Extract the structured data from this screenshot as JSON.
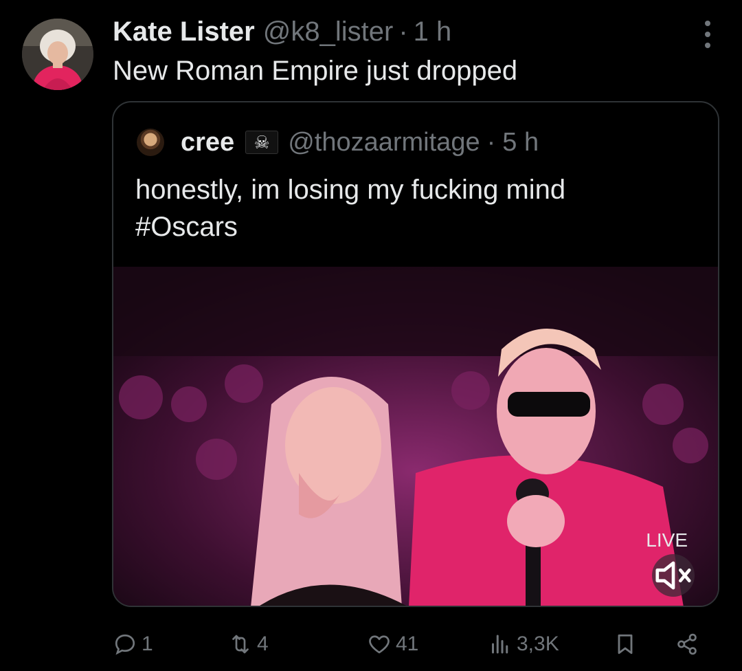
{
  "tweet": {
    "author_name": "Kate Lister",
    "author_handle": "@k8_lister",
    "separator": "·",
    "time": "1 h",
    "text": "New Roman Empire just dropped"
  },
  "quoted": {
    "author_name": "cree",
    "flag_icon": "pirate-flag-icon",
    "flag_glyph": "☠",
    "author_handle": "@thozaarmitage",
    "separator": "·",
    "time": "5 h",
    "text": "honestly, im losing my fucking mind\n#Oscars",
    "media": {
      "badge": "LIVE",
      "mute_icon": "muted-speaker-icon"
    }
  },
  "actions": {
    "replies": "1",
    "retweets": "4",
    "likes": "41",
    "views": "3,3K"
  },
  "colors": {
    "background": "#000000",
    "text": "#e7e9ea",
    "secondary": "#71767b",
    "border": "#2f3336"
  }
}
